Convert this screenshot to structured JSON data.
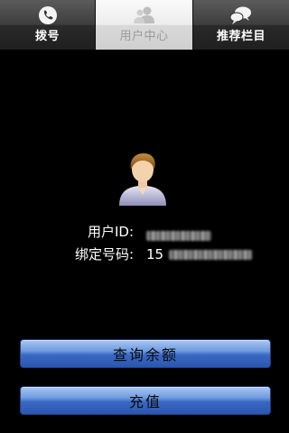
{
  "tabs": [
    {
      "label": "拨号",
      "icon": "dial-icon",
      "active": false
    },
    {
      "label": "用户中心",
      "icon": "users-icon",
      "active": true
    },
    {
      "label": "推荐栏目",
      "icon": "chat-bubbles-icon",
      "active": false
    }
  ],
  "user_info": {
    "user_id_label": "用户ID:",
    "user_id_value_prefix": "",
    "bound_number_label": "绑定号码:",
    "bound_number_value_prefix": "15"
  },
  "buttons": {
    "query_balance": "查询余额",
    "recharge": "充值"
  },
  "colors": {
    "background": "#000000",
    "button_blue": "#3a68c4",
    "active_tab": "#e6e6e6"
  }
}
